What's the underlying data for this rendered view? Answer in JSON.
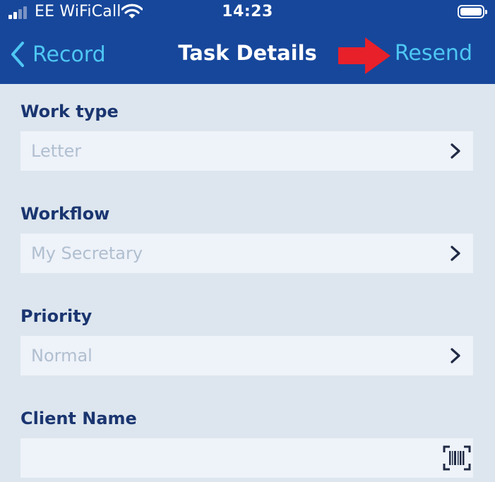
{
  "status_bar": {
    "carrier": "EE WiFiCall",
    "time": "14:23",
    "icons": [
      "signal-icon",
      "wifi-icon",
      "battery-icon"
    ]
  },
  "nav": {
    "back_label": "Record",
    "title": "Task Details",
    "action_label": "Resend",
    "annotation": "red-arrow-icon"
  },
  "form": {
    "work_type": {
      "label": "Work type",
      "value": "Letter"
    },
    "workflow": {
      "label": "Workflow",
      "value": "My Secretary"
    },
    "priority": {
      "label": "Priority",
      "value": "Normal"
    },
    "client_name": {
      "label": "Client Name",
      "value": "",
      "icon": "barcode-scan-icon"
    }
  },
  "colors": {
    "header_bg": "#17479b",
    "accent": "#4ec7f3",
    "content_bg": "#dde6ee",
    "label_text": "#1a3570",
    "field_bg": "#eef2f9",
    "placeholder_text": "#b0bfd0",
    "annotation_arrow": "#e8202a"
  }
}
